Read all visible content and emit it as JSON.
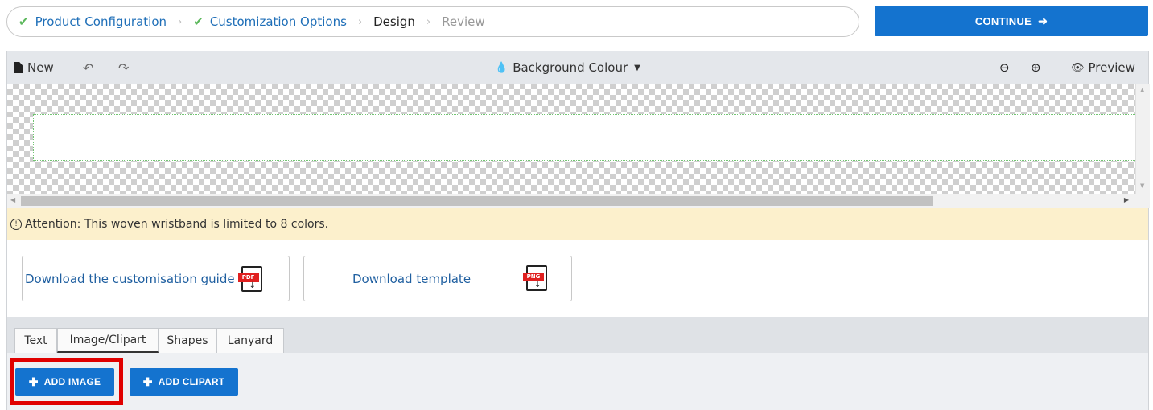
{
  "breadcrumb": {
    "steps": [
      {
        "label": "Product Configuration",
        "state": "done"
      },
      {
        "label": "Customization Options",
        "state": "done"
      },
      {
        "label": "Design",
        "state": "current"
      },
      {
        "label": "Review",
        "state": "future"
      }
    ],
    "separator": "›",
    "check_glyph": "✔"
  },
  "continue": {
    "label": "CONTINUE",
    "arrow": "➜"
  },
  "toolbar": {
    "new_label": "New",
    "undo_glyph": "↶",
    "redo_glyph": "↷",
    "background_label": "Background Colour",
    "drop_glyph": "💧",
    "caret_glyph": "▼",
    "zoom_out_glyph": "⊖",
    "zoom_in_glyph": "⊕",
    "preview_label": "Preview",
    "eye_glyph": "👁"
  },
  "attention": {
    "icon_glyph": "!",
    "text": "Attention: This woven wristband is limited to 8 colors."
  },
  "downloads": {
    "guide_label": "Download the customisation guide",
    "guide_file_type": "PDF",
    "template_label": "Download template",
    "template_file_type": "PNG"
  },
  "tabs": [
    {
      "label": "Text"
    },
    {
      "label": "Image/Clipart"
    },
    {
      "label": "Shapes"
    },
    {
      "label": "Lanyard"
    }
  ],
  "actions": {
    "add_image_label": "ADD IMAGE",
    "add_clipart_label": "ADD CLIPART",
    "plus_glyph": "✚"
  },
  "colors": {
    "primary": "#1473cf",
    "link": "#1f6fb8",
    "check": "#5cb85c",
    "attention_bg": "#fcf0cc",
    "highlight": "#e00000",
    "file_tag": "#e02020"
  },
  "icons": [
    "check-icon",
    "arrow-right-icon",
    "document-icon",
    "undo-icon",
    "redo-icon",
    "drop-icon",
    "caret-down-icon",
    "zoom-out-icon",
    "zoom-in-icon",
    "eye-icon",
    "info-icon",
    "pdf-file-icon",
    "png-file-icon",
    "plus-icon"
  ]
}
